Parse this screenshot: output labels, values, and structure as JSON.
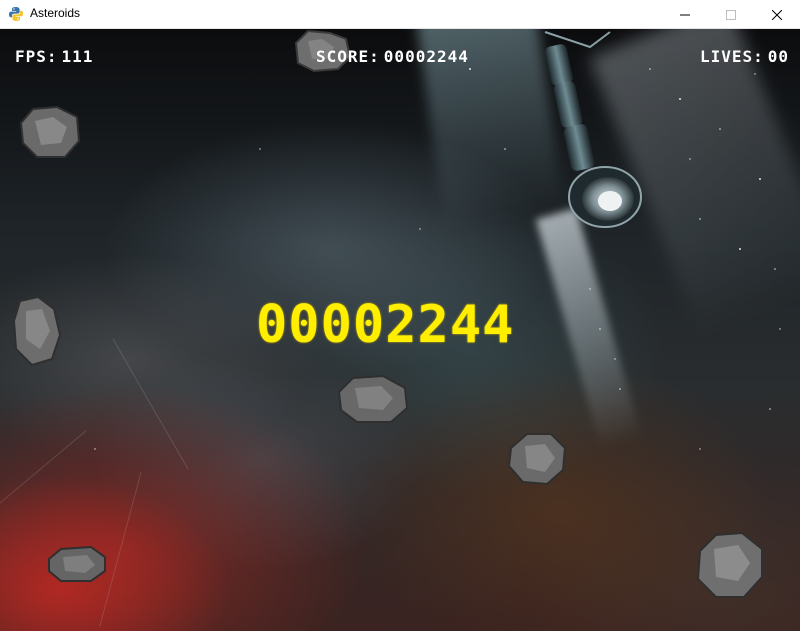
{
  "window": {
    "title": "Asteroids",
    "app_icon": "python-icon",
    "controls": [
      "minimize-icon",
      "maximize-icon",
      "close-icon"
    ]
  },
  "hud": {
    "fps_label": "FPS:",
    "fps_value": "111",
    "score_label": "SCORE:",
    "score_value": "00002244",
    "lives_label": "LIVES:",
    "lives_value": "00"
  },
  "center_score": "00002244",
  "colors": {
    "hud_text": "#ffffff",
    "center_score": "#ffee00"
  },
  "sprites": [
    "asteroid",
    "asteroid",
    "asteroid",
    "asteroid",
    "asteroid",
    "asteroid",
    "asteroid",
    "space-station"
  ]
}
